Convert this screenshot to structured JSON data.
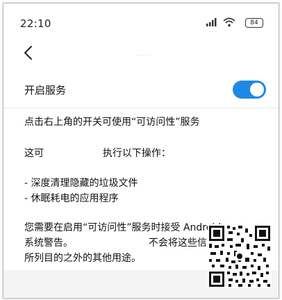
{
  "status_bar": {
    "time": "22:10",
    "battery": "84",
    "icons": [
      "signal-icon",
      "wifi-icon",
      "battery-icon"
    ]
  },
  "nav": {
    "back_icon": "chevron-left-icon",
    "title": "......"
  },
  "service": {
    "label": "开启服务",
    "enabled": true,
    "accent": "#1e88e5"
  },
  "content": {
    "line1": "点击右上角的开关可使用“可访问性”服务",
    "line2_start": "这可",
    "line2_end": "执行以下操作：",
    "item1": "- 深度清理隐藏的垃圾文件",
    "item2": "- 休眠耗电的应用程序",
    "warning_line1": "您需要在启用“可访问性”服务时接受 Android",
    "warning_line2_start": "系统警告。",
    "warning_line2_end": "不会将这些信息",
    "warning_line3": "所列目的之外的其他用途。"
  },
  "overlay": {
    "qr": "qr-code"
  }
}
